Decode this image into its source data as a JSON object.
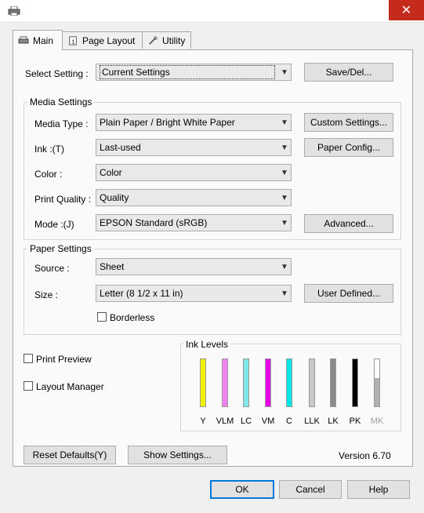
{
  "window": {
    "close_label": "✕"
  },
  "tabs": [
    {
      "label": "Main"
    },
    {
      "label": "Page Layout"
    },
    {
      "label": "Utility"
    }
  ],
  "select_setting": {
    "label": "Select Setting :",
    "value": "Current Settings",
    "button": "Save/Del..."
  },
  "media_settings": {
    "title": "Media Settings",
    "media_type": {
      "label": "Media Type :",
      "value": "Plain Paper / Bright White Paper"
    },
    "ink": {
      "label": "Ink :(T)",
      "value": "Last-used"
    },
    "color": {
      "label": "Color :",
      "value": "Color"
    },
    "print_quality": {
      "label": "Print Quality :",
      "value": "Quality"
    },
    "mode": {
      "label": "Mode :(J)",
      "value": "EPSON Standard (sRGB)"
    },
    "custom_settings_button": "Custom Settings...",
    "paper_config_button": "Paper Config...",
    "advanced_button": "Advanced..."
  },
  "paper_settings": {
    "title": "Paper Settings",
    "source": {
      "label": "Source :",
      "value": "Sheet"
    },
    "size": {
      "label": "Size :",
      "value": "Letter (8 1/2 x 11 in)"
    },
    "user_defined_button": "User Defined...",
    "borderless": {
      "label": "Borderless",
      "checked": false
    }
  },
  "print_preview": {
    "label": "Print Preview",
    "checked": false
  },
  "layout_manager": {
    "label": "Layout Manager",
    "checked": false
  },
  "ink_levels": {
    "title": "Ink Levels",
    "inks": [
      {
        "label": "Y",
        "color": "#f2f200",
        "level": 1.0
      },
      {
        "label": "VLM",
        "color": "#ee82ee",
        "level": 1.0
      },
      {
        "label": "LC",
        "color": "#7fe7e7",
        "level": 1.0
      },
      {
        "label": "VM",
        "color": "#e600e6",
        "level": 1.0
      },
      {
        "label": "C",
        "color": "#00e5e5",
        "level": 1.0
      },
      {
        "label": "LLK",
        "color": "#c8c8c8",
        "level": 1.0
      },
      {
        "label": "LK",
        "color": "#8a8a8a",
        "level": 1.0
      },
      {
        "label": "PK",
        "color": "#000000",
        "level": 1.0
      },
      {
        "label": "MK",
        "color": "#b0b0b0",
        "level": 0.6
      }
    ]
  },
  "reset_defaults_button": "Reset Defaults(Y)",
  "show_settings_button": "Show Settings...",
  "version": "Version 6.70",
  "dialog_buttons": {
    "ok": "OK",
    "cancel": "Cancel",
    "help": "Help"
  }
}
